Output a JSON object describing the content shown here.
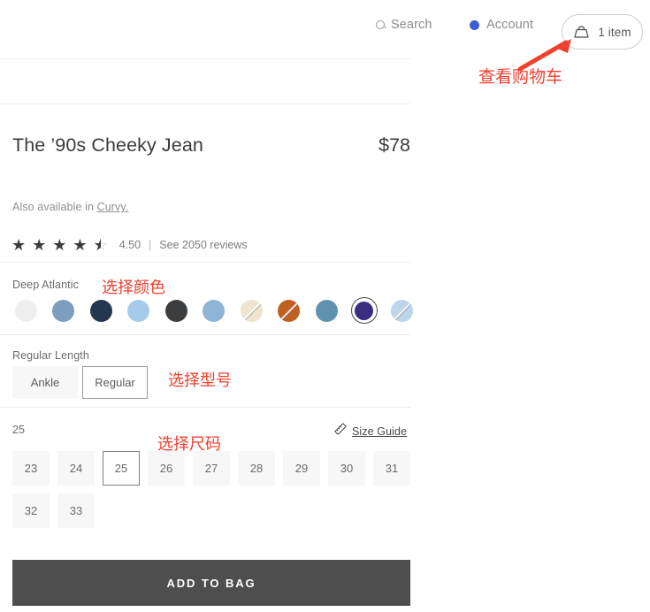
{
  "nav": {
    "search_label": "Search",
    "search_icon": "search-icon",
    "account_label": "Account",
    "account_icon": "account-dot-icon",
    "cart_label": "1 item",
    "cart_icon": "shopping-bag-icon"
  },
  "product": {
    "title": "The ’90s Cheeky Jean",
    "price": "$78",
    "also_available_prefix": "Also available in ",
    "also_available_link": "Curvy."
  },
  "rating": {
    "value": "4.50",
    "separator": "|",
    "reviews_label": "See 2050 reviews",
    "stars_full": 4,
    "stars_half": 1,
    "stars_total": 5
  },
  "color": {
    "selected_name": "Deep Atlantic",
    "swatches": [
      {
        "name": "Off White",
        "hex": "#eeeeee",
        "unavailable": false,
        "selected": false
      },
      {
        "name": "Medium Blue",
        "hex": "#7e9ec0",
        "unavailable": false,
        "selected": false
      },
      {
        "name": "Dark Navy",
        "hex": "#23374f",
        "unavailable": false,
        "selected": false
      },
      {
        "name": "Light Sky Blue",
        "hex": "#a6cbe8",
        "unavailable": false,
        "selected": false
      },
      {
        "name": "Washed Black",
        "hex": "#3b3d3f",
        "unavailable": false,
        "selected": false
      },
      {
        "name": "Sky Blue",
        "hex": "#8fb4d6",
        "unavailable": false,
        "selected": false
      },
      {
        "name": "Ecru",
        "hex": "#efe4ce",
        "unavailable": true,
        "selected": false
      },
      {
        "name": "Burnt Orange",
        "hex": "#bf5f22",
        "unavailable": true,
        "selected": false
      },
      {
        "name": "Teal Blue",
        "hex": "#5f93ad",
        "unavailable": false,
        "selected": false
      },
      {
        "name": "Deep Atlantic",
        "hex": "#3b2d82",
        "unavailable": false,
        "selected": true
      },
      {
        "name": "Pale Blue",
        "hex": "#bed5ea",
        "unavailable": true,
        "selected": false
      }
    ]
  },
  "length": {
    "selected_label": "Regular Length",
    "options": [
      {
        "label": "Ankle",
        "selected": false
      },
      {
        "label": "Regular",
        "selected": true
      }
    ]
  },
  "size": {
    "selected_label": "25",
    "size_guide_label": "Size Guide",
    "size_guide_icon": "ruler-icon",
    "options": [
      {
        "label": "23",
        "selected": false
      },
      {
        "label": "24",
        "selected": false
      },
      {
        "label": "25",
        "selected": true
      },
      {
        "label": "26",
        "selected": false
      },
      {
        "label": "27",
        "selected": false
      },
      {
        "label": "28",
        "selected": false
      },
      {
        "label": "29",
        "selected": false
      },
      {
        "label": "30",
        "selected": false
      },
      {
        "label": "31",
        "selected": false
      },
      {
        "label": "32",
        "selected": false
      },
      {
        "label": "33",
        "selected": false
      }
    ]
  },
  "cta": {
    "add_to_bag_label": "ADD TO BAG"
  },
  "annotations": {
    "cart": "查看购物车",
    "color": "选择颜色",
    "length": "选择型号",
    "size": "选择尺码",
    "color_hex": "#f0402f"
  }
}
